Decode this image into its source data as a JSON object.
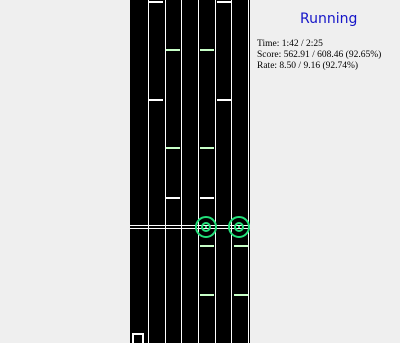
{
  "status": {
    "title": "Running",
    "title_color": "#1515c8"
  },
  "stats": {
    "time": "Time: 1:42 / 2:25",
    "score": "Score: 562.91 / 608.46 (92.65%)",
    "rate": "Rate: 8.50 / 9.16 (92.74%)"
  },
  "playfield": {
    "background": "#000000",
    "lane_count": 6,
    "note_color": "#ffffff",
    "receptor_color": "#22e07a",
    "receptor_icon": "target-ring-icon"
  }
}
